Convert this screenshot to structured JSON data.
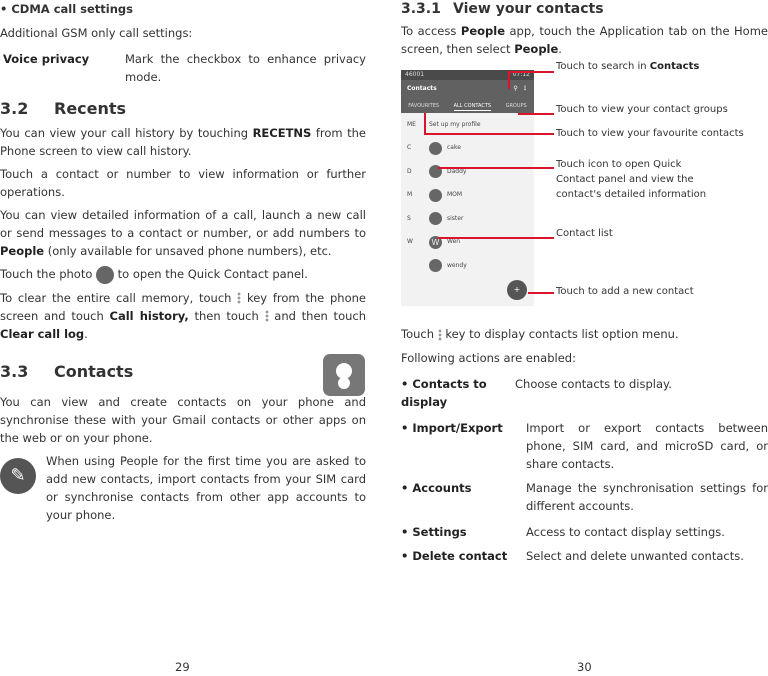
{
  "left": {
    "bullet_title": "CDMA call settings",
    "intro": "Additional GSM only call settings:",
    "voice_term": "Voice privacy",
    "voice_desc": "Mark the checkbox to enhance privacy mode.",
    "s32_num": "3.2",
    "s32_title": "Recents",
    "p1a": "You can view your call history by touching ",
    "p1b": "RECETNS",
    "p1c": " from the Phone screen to view call history.",
    "p2": "Touch a contact or number to view information or further operations.",
    "p3a": "You can view detailed information of a call, launch a new call or send messages to a contact or number, or add numbers to ",
    "p3b": "People",
    "p3c": " (only available for unsaved phone numbers), etc.",
    "p4a": "Touch the photo ",
    "p4b": " to open the Quick Contact panel.",
    "p5a": "To clear the entire call memory, touch ",
    "p5b": " key from the phone screen and touch ",
    "p5c": "Call history,",
    "p5d": " then touch ",
    "p5e": " and then touch ",
    "p5f": "Clear call log",
    "s33_num": "3.3",
    "s33_title": "Contacts",
    "p6": "You can view and create contacts on your phone and synchronise these with your Gmail contacts or other apps on the web or on your phone.",
    "tip": "When using People for the first time you are asked to add new contacts, import contacts from your SIM card or synchronise contacts from other app accounts to your phone.",
    "page": "29"
  },
  "right": {
    "s331_num": "3.3.1",
    "s331_title": "View your contacts",
    "p1a": "To access ",
    "p1b": "People",
    "p1c": " app, touch the Application tab on the Home screen, then select ",
    "p1d": "People",
    "phone": {
      "status_left": "46001",
      "time": "07:12",
      "title": "Contacts",
      "tabs": [
        "FAVOURITES",
        "ALL CONTACTS",
        "GROUPS"
      ],
      "contacts": [
        {
          "letter": "ME",
          "name": "Set up my profile"
        },
        {
          "letter": "C",
          "name": "cake"
        },
        {
          "letter": "D",
          "name": "Daddy"
        },
        {
          "letter": "M",
          "name": "MOM"
        },
        {
          "letter": "S",
          "name": "sister"
        },
        {
          "letter": "W",
          "name": "Wen",
          "initial": "W"
        },
        {
          "letter": "",
          "name": "wendy"
        }
      ]
    },
    "callouts": {
      "search_a": "Touch to search in ",
      "search_b": "Contacts",
      "groups": "Touch to view your contact groups",
      "favourites": "Touch to view your favourite contacts",
      "quick1": "Touch icon to open Quick",
      "quick2": "Contact panel and view the",
      "quick3": "contact's detailed information",
      "list": "Contact list",
      "add": "Touch to add a new contact"
    },
    "p2a": "Touch ",
    "p2b": " key to display contacts list option menu.",
    "p3": "Following actions are enabled:",
    "actions": [
      {
        "term": "Contacts to display",
        "desc": "Choose contacts to display."
      },
      {
        "term": "Import/Export",
        "desc": "Import or export contacts between phone, SIM card, and microSD card, or share contacts."
      },
      {
        "term": "Accounts",
        "desc": "Manage the synchronisation settings for different accounts."
      },
      {
        "term": "Settings",
        "desc": "Access to contact display settings."
      },
      {
        "term": "Delete contact",
        "desc": "Select and delete unwanted contacts."
      }
    ],
    "page": "30"
  }
}
